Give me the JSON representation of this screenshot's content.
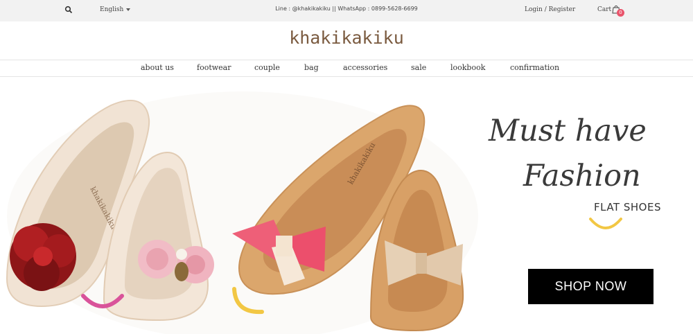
{
  "topbar": {
    "search_icon": "search-icon",
    "language": "English",
    "contact": "Line : @khakikakiku  ||  WhatsApp : 0899-5628-6699",
    "login": "Login / Register",
    "cart_label": "Cart",
    "cart_icon": "shopping-bag-icon",
    "cart_count": "0"
  },
  "brand": {
    "logo": "khakikakiku"
  },
  "nav": {
    "items": [
      "about us",
      "footwear",
      "couple",
      "bag",
      "accessories",
      "sale",
      "lookbook",
      "confirmation"
    ]
  },
  "hero": {
    "headline_line1": "Must have",
    "headline_line2": "Fashion",
    "subheadline": "FLAT SHOES",
    "cta": "SHOP NOW",
    "insole_brand": "khakikakiku",
    "colors": {
      "accent_yellow": "#f2c744",
      "accent_pink": "#d9539a",
      "cream_shoe": "#f0e2d2",
      "tan_shoe": "#d9a46a",
      "red_flower": "#9b1a1c",
      "pink_roses": "#f0b8c2"
    }
  }
}
